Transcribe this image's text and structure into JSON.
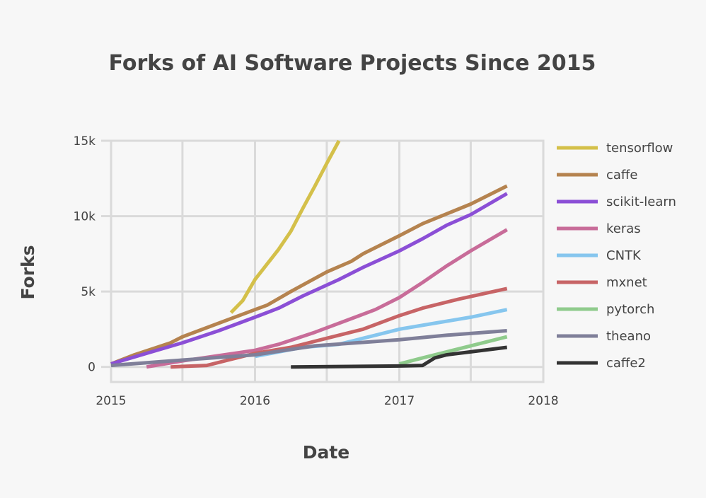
{
  "chart_data": {
    "type": "line",
    "title": "Forks of AI Software Projects Since 2015",
    "xlabel": "Date",
    "ylabel": "Forks",
    "x_axis": {
      "type": "date",
      "min": "2015-01-01",
      "max": "2018-01-01",
      "ticks": [
        "2015-01-01",
        "2016-01-01",
        "2017-01-01",
        "2018-01-01"
      ],
      "tick_labels": [
        "2015",
        "2016",
        "2017",
        "2018"
      ]
    },
    "y_axis": {
      "min": -1000,
      "max": 15000,
      "ticks": [
        0,
        5000,
        10000,
        15000
      ],
      "tick_labels": [
        "0",
        "5k",
        "10k",
        "15k"
      ]
    },
    "grid": true,
    "legend": "right",
    "series": [
      {
        "name": "tensorflow",
        "color": "#d4c04a",
        "x": [
          "2015-11-01",
          "2015-12-01",
          "2016-01-01",
          "2016-03-01",
          "2016-04-01",
          "2016-05-01",
          "2016-06-01",
          "2016-07-01",
          "2016-08-01"
        ],
        "y": [
          3600,
          4400,
          5800,
          7800,
          9000,
          10500,
          12000,
          13500,
          15000
        ]
      },
      {
        "name": "caffe",
        "color": "#b5834f",
        "x": [
          "2015-01-01",
          "2015-03-01",
          "2015-06-01",
          "2015-07-01",
          "2015-10-01",
          "2016-01-01",
          "2016-02-01",
          "2016-04-01",
          "2016-07-01",
          "2016-09-01",
          "2016-10-01",
          "2017-01-01",
          "2017-03-01",
          "2017-07-01",
          "2017-10-01"
        ],
        "y": [
          200,
          800,
          1600,
          2000,
          2900,
          3800,
          4100,
          5000,
          6300,
          7000,
          7500,
          8700,
          9500,
          10800,
          12000
        ]
      },
      {
        "name": "scikit-learn",
        "color": "#8b4fd6",
        "x": [
          "2015-01-01",
          "2015-04-01",
          "2015-07-01",
          "2015-10-01",
          "2016-01-01",
          "2016-03-01",
          "2016-05-01",
          "2016-08-01",
          "2016-10-01",
          "2017-01-01",
          "2017-03-01",
          "2017-05-01",
          "2017-07-01",
          "2017-10-01"
        ],
        "y": [
          200,
          900,
          1600,
          2400,
          3300,
          3900,
          4700,
          5800,
          6600,
          7700,
          8500,
          9400,
          10100,
          11500
        ]
      },
      {
        "name": "keras",
        "color": "#c86c99",
        "x": [
          "2015-04-01",
          "2015-07-01",
          "2015-10-01",
          "2016-01-01",
          "2016-03-01",
          "2016-06-01",
          "2016-09-01",
          "2016-11-01",
          "2017-01-01",
          "2017-03-01",
          "2017-05-01",
          "2017-07-01",
          "2017-10-01"
        ],
        "y": [
          0,
          400,
          750,
          1100,
          1500,
          2300,
          3200,
          3800,
          4600,
          5600,
          6700,
          7700,
          9100
        ]
      },
      {
        "name": "CNTK",
        "color": "#86c6ee",
        "x": [
          "2016-01-01",
          "2016-05-01",
          "2016-08-01",
          "2016-11-01",
          "2017-01-01",
          "2017-04-01",
          "2017-07-01",
          "2017-10-01"
        ],
        "y": [
          700,
          1300,
          1500,
          2100,
          2500,
          2900,
          3300,
          3800
        ]
      },
      {
        "name": "mxnet",
        "color": "#c76466",
        "x": [
          "2015-06-01",
          "2015-09-01",
          "2015-11-01",
          "2016-01-01",
          "2016-04-01",
          "2016-07-01",
          "2016-10-01",
          "2017-01-01",
          "2017-03-01",
          "2017-06-01",
          "2017-10-01"
        ],
        "y": [
          0,
          100,
          500,
          900,
          1300,
          1900,
          2500,
          3400,
          3900,
          4500,
          5200
        ]
      },
      {
        "name": "pytorch",
        "color": "#8fcb8c",
        "x": [
          "2017-01-01",
          "2017-03-01",
          "2017-05-01",
          "2017-07-01",
          "2017-10-01"
        ],
        "y": [
          200,
          600,
          1000,
          1400,
          2000
        ]
      },
      {
        "name": "theano",
        "color": "#7f7f99",
        "x": [
          "2015-01-01",
          "2015-06-01",
          "2016-01-01",
          "2016-06-01",
          "2017-01-01",
          "2017-05-01",
          "2017-10-01"
        ],
        "y": [
          100,
          400,
          800,
          1400,
          1800,
          2100,
          2400
        ]
      },
      {
        "name": "caffe2",
        "color": "#333333",
        "x": [
          "2016-04-01",
          "2016-09-01",
          "2017-01-01",
          "2017-03-01",
          "2017-04-01",
          "2017-05-01",
          "2017-07-01",
          "2017-10-01"
        ],
        "y": [
          0,
          30,
          60,
          100,
          600,
          800,
          1000,
          1300
        ]
      }
    ]
  }
}
